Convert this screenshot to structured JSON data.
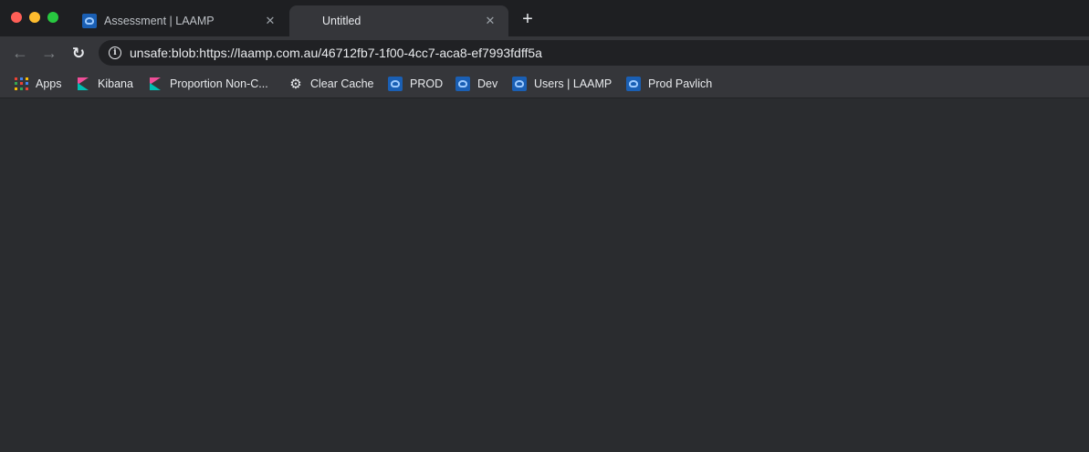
{
  "window": {
    "controls": [
      "close",
      "minimize",
      "zoom"
    ]
  },
  "tabs": [
    {
      "title": "Assessment | LAAMP",
      "icon": "laamp-favicon",
      "active": false,
      "close_glyph": "✕"
    },
    {
      "title": "Untitled",
      "icon": "",
      "active": true,
      "close_glyph": "✕"
    }
  ],
  "newtab_glyph": "+",
  "toolbar": {
    "back_glyph": "←",
    "forward_glyph": "→",
    "reload_glyph": "↻",
    "info_glyph": "i",
    "url": "unsafe:blob:https://laamp.com.au/46712fb7-1f00-4cc7-aca8-ef7993fdff5a"
  },
  "bookmarks": [
    {
      "label": "Apps",
      "icon": "apps-grid-icon"
    },
    {
      "label": "Kibana",
      "icon": "kibana-icon"
    },
    {
      "label": "Proportion Non-C...",
      "icon": "kibana-icon"
    },
    {
      "label": "Clear Cache",
      "icon": "gear-icon"
    },
    {
      "label": "PROD",
      "icon": "laamp-icon"
    },
    {
      "label": "Dev",
      "icon": "laamp-icon"
    },
    {
      "label": "Users | LAAMP",
      "icon": "laamp-icon"
    },
    {
      "label": "Prod Pavlich",
      "icon": "laamp-icon"
    }
  ],
  "colors": {
    "tabstrip": "#1e1f22",
    "toolbar": "#35363a",
    "omnibox": "#202124",
    "content": "#2a2c2f",
    "laamp_brand": "#1a5fb4"
  }
}
